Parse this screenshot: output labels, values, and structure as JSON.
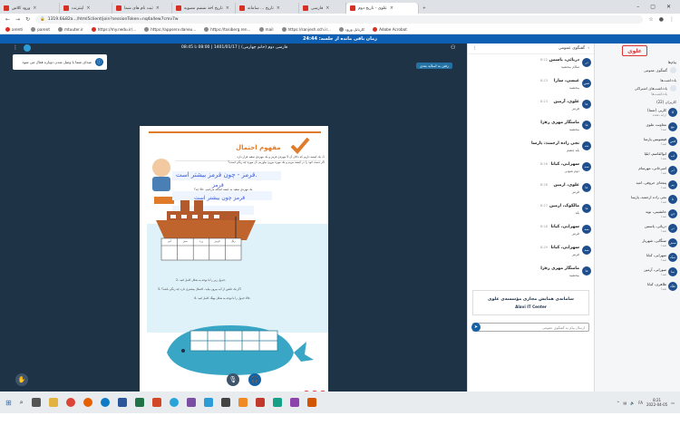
{
  "browser": {
    "tabs": [
      {
        "label": "ورود کلاس"
      },
      {
        "label": "اینترنت"
      },
      {
        "label": "ثبت نام های شما"
      },
      {
        "label": "تاریخ اخذ ششم مصوبه"
      },
      {
        "label": "تاریخ ... سامانه"
      },
      {
        "label": "فارسی"
      },
      {
        "label": "علوی - تاریخ دوم"
      }
    ],
    "new_tab": "+",
    "url": "1319.6&82a.../html5client/join?sessionToken=nq4a4ew7cmv7w",
    "bookmarks": [
      "arenti",
      "parent",
      "mtuuter.ir",
      "https://my.nedu.ir/...",
      "https://appserv.daneu...",
      "https://tosiberg.ren...",
      "mail",
      "https://sanjesh.sch.ir...",
      "کارتابل ورود",
      "Adobe Acrobat"
    ]
  },
  "app": {
    "timer": "زمان باقی مانده از جلسه: 24:44",
    "session_title": "فارسی دوم (خانم چهارمی) | 1401/01/17 | 08:00 تا 08:45",
    "notice": "صدای شما با وصل شدن دوباره فعال می شود",
    "slide_button": "رفتن به اسلاید بعدی",
    "page_number": "117"
  },
  "chat": {
    "header": "گفتگوی عمومی",
    "messages": [
      {
        "initials": "در",
        "name": "دریائی، یاسمن",
        "time": "8:22",
        "text": "سلام ببخشید"
      },
      {
        "initials": "عس",
        "name": "عیسی، سارا",
        "time": "8:23",
        "text": "ببخشید"
      },
      {
        "initials": "عا",
        "name": "علوی، آرمین",
        "time": "8:23",
        "text": "قرمز"
      },
      {
        "initials": "ما",
        "name": "مامنگار مهری زهرا",
        "time": "8:24",
        "text": "ببخشید"
      },
      {
        "initials": "نت",
        "name": "نجی زاده ارجمند، پارسا",
        "time": "8:25",
        "text": "بله چشم"
      },
      {
        "initials": "سه",
        "name": "سهرابی، کیانا",
        "time": "8:26",
        "text": "دوم شوتی"
      },
      {
        "initials": "عا",
        "name": "علوی، ارمین",
        "time": "8:26",
        "text": "قرمز"
      },
      {
        "initials": "ما",
        "name": "مالکوک، ارمین",
        "time": "8:27",
        "text": "بله"
      },
      {
        "initials": "سه",
        "name": "سهرابی، کیانا",
        "time": "8:28",
        "text": "قرمز"
      },
      {
        "initials": "سه",
        "name": "سهرابی، کیانا",
        "time": "8:29",
        "text": "قرمز"
      },
      {
        "initials": "ما",
        "name": "مامنگار مهری زهرا",
        "time": "8:30",
        "text": "ببخشید"
      }
    ],
    "banner_title": "سامانه‌ی همایش مجازی مؤسسه‌ی علوی",
    "banner_sub": "Alavi IT Center",
    "input_placeholder": "ارسال پیام به گفتگوی عمومی"
  },
  "sidebar": {
    "logo": "علوی",
    "section_messages": "پیام‌ها",
    "public_chat": "گفتگوی عمومی",
    "section_notes": "یادداشت‌ها",
    "shared_notes": "یادداشت‌های اشتراکی",
    "shared_notes_sub": "یادداشت‌ها",
    "users_label": "کاربران (22)",
    "users": [
      {
        "initials": "کا",
        "name": "کاربر، (شما)",
        "status": "ارائه دهنده"
      },
      {
        "initials": "مع",
        "name": "معاونت علوی",
        "status": "صدا"
      },
      {
        "initials": "فس",
        "name": "فیشونس پارسا",
        "status": "صدا"
      },
      {
        "initials": "اب",
        "name": "ابوالقاسم، ایلیا",
        "status": "صدا"
      },
      {
        "initials": "ام",
        "name": "امیرخانی، مهرسام",
        "status": "صدا"
      },
      {
        "initials": "پم",
        "name": "پنجه‌ای حروفی، امید",
        "status": "صدا"
      },
      {
        "initials": "نا",
        "name": "نجی زاده ارجمند، پارسا",
        "status": "صدا"
      },
      {
        "initials": "جن",
        "name": "جانشینی، نوید",
        "status": "صدا"
      },
      {
        "initials": "در",
        "name": "دریائی، یاسمن",
        "status": "صدا"
      },
      {
        "initials": "سش",
        "name": "سنگایی، شهریار",
        "status": "صدا"
      },
      {
        "initials": "سک",
        "name": "سهرابی، کیانا",
        "status": "صدا"
      },
      {
        "initials": "سا",
        "name": "سورانی، آرمین",
        "status": "صدا"
      },
      {
        "initials": "طک",
        "name": "طاهری، کیانا",
        "status": "صدا"
      }
    ]
  },
  "slide": {
    "heading": "مفهوم احتمال",
    "side_label": "فعالیت",
    "line1": "1- یک کیسه داریم که داخل آن 5 مهره‌ی قرمز و یک مهره‌ی سفید قرار دارد.",
    "line2": "اگر دست خود را در کیسه ببریم و یک مهره بیرون بیاوریم، آن مهره چه رنگی است؟",
    "handwriting1": "قرمز - چون قرمز بیشتر است.",
    "handwriting2": "قرمز",
    "line3": "یک مهره‌ی سفید به کیسه اضافه می‌کنیم. حالا چه؟",
    "handwriting3": "قرمز چون بیشتر است",
    "table_headers": [
      "آبی",
      "سبز",
      "زرد",
      "قرمز",
      "رنگ"
    ],
    "q2": "2- جدول زیر را با توجه به شکل کامل کنید.",
    "q3": "3- اگر یک دلفین از آب بیرون بیاید، احتمال بیشتری دارد چه رنگی باشد؟",
    "q4": "4- حالا جدول را با توجه به شکل نهنگ کامل کنید.",
    "whale_rows": [
      "رنگ",
      "تعداد"
    ]
  },
  "taskbar": {
    "lang": "FA",
    "time": "8:21",
    "date": "2022-04-05"
  },
  "colors": {
    "primary": "#0d5fb3",
    "dark_bg": "#1f3347",
    "heading_orange": "#e07b2a",
    "whale_blue": "#3aa6c6",
    "ship_brown": "#b25a2b"
  }
}
